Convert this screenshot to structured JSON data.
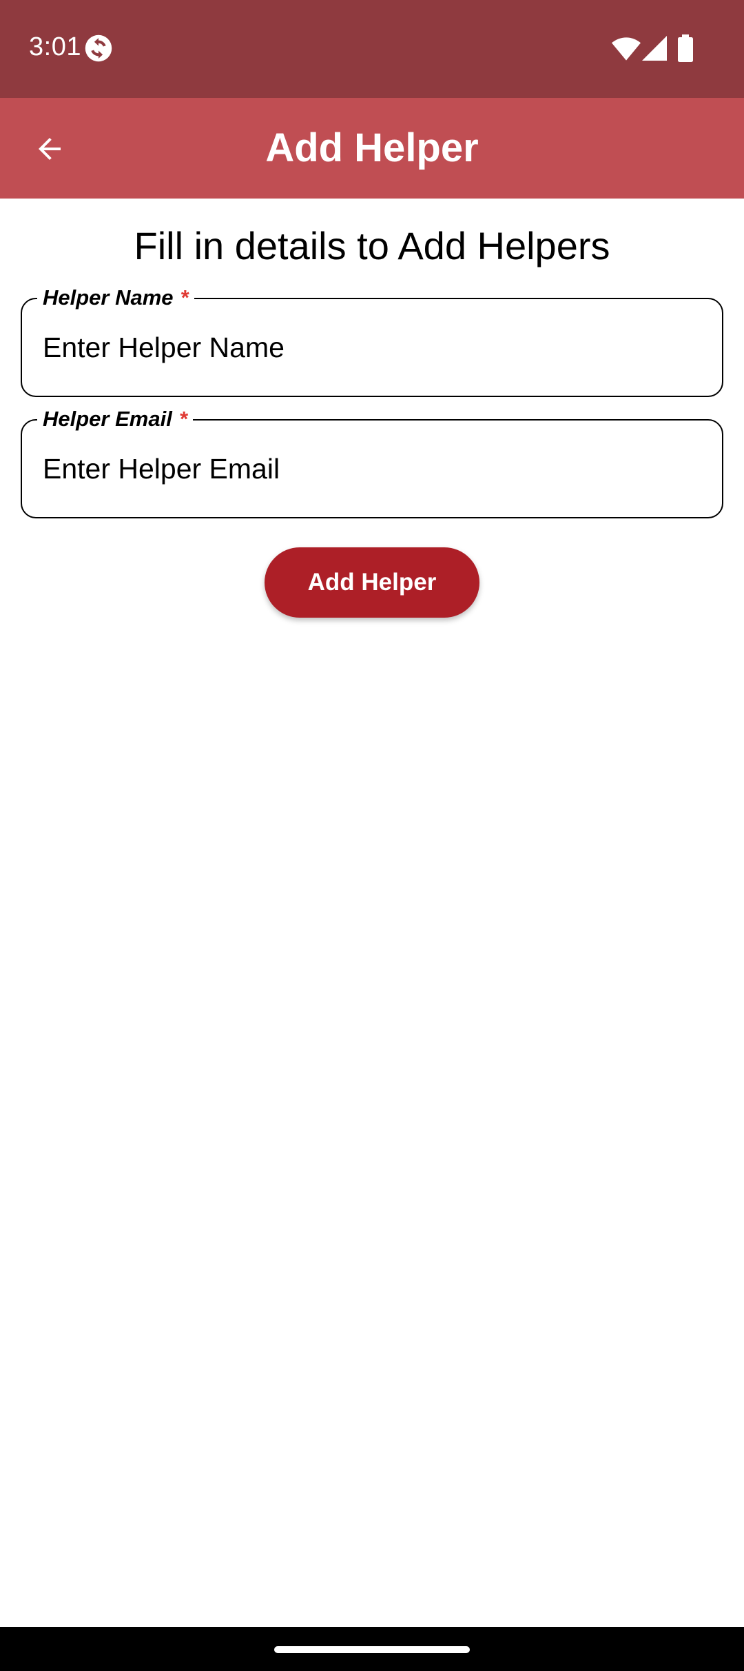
{
  "status_bar": {
    "time": "3:01",
    "icons": [
      "sync-icon",
      "wifi-icon",
      "signal-icon",
      "battery-icon"
    ]
  },
  "app_bar": {
    "title": "Add Helper",
    "back_icon": "arrow-left-icon",
    "background_color": "#c04e53"
  },
  "form": {
    "heading": "Fill in details to Add Helpers",
    "fields": [
      {
        "label": "Helper Name",
        "required_mark": "*",
        "value": "",
        "placeholder": "Enter Helper Name"
      },
      {
        "label": "Helper Email",
        "required_mark": "*",
        "value": "",
        "placeholder": "Enter Helper Email"
      }
    ],
    "submit_label": "Add Helper",
    "submit_color": "#ad1f27"
  },
  "colors": {
    "status_bar": "#8f3a3f",
    "required": "#e03a34"
  }
}
